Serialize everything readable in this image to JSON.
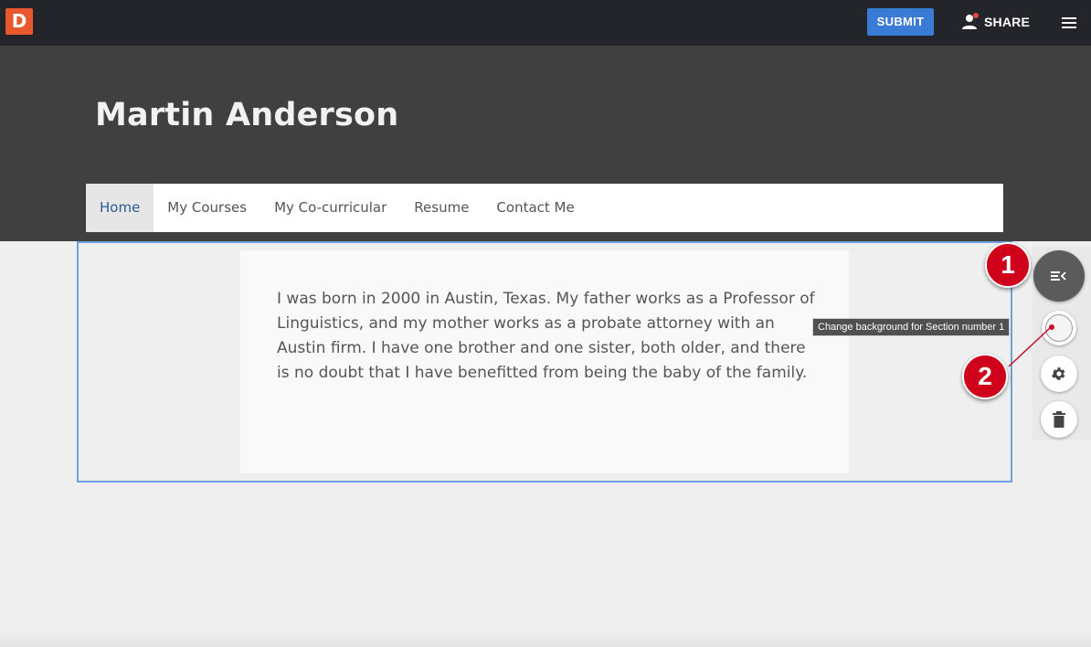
{
  "topbar": {
    "logo_letter": "D",
    "submit_label": "SUBMIT",
    "share_label": "SHARE"
  },
  "site": {
    "title": "Martin Anderson"
  },
  "nav": {
    "items": [
      {
        "label": "Home",
        "active": true
      },
      {
        "label": "My Courses",
        "active": false
      },
      {
        "label": "My Co-curricular",
        "active": false
      },
      {
        "label": "Resume",
        "active": false
      },
      {
        "label": "Contact Me",
        "active": false
      }
    ]
  },
  "section": {
    "body_text": "I was born in 2000 in Austin, Texas. My father works as a Professor of Linguistics, and my mother works as a probate attorney with an Austin firm. I have one brother and one sister, both older, and there is no doubt that I have benefitted from being the baby of the family."
  },
  "tools": {
    "tooltip": "Change background for Section number 1",
    "icons": [
      "collapse-menu-icon",
      "background-color-icon",
      "gear-icon",
      "trash-icon"
    ]
  },
  "callouts": {
    "first": "1",
    "second": "2"
  },
  "colors": {
    "topbar": "#24252a",
    "header": "#404040",
    "accent_blue": "#3a7bd5",
    "logo": "#e8572e",
    "callout_red": "#d0021b",
    "section_outline": "#6fa0e0"
  }
}
